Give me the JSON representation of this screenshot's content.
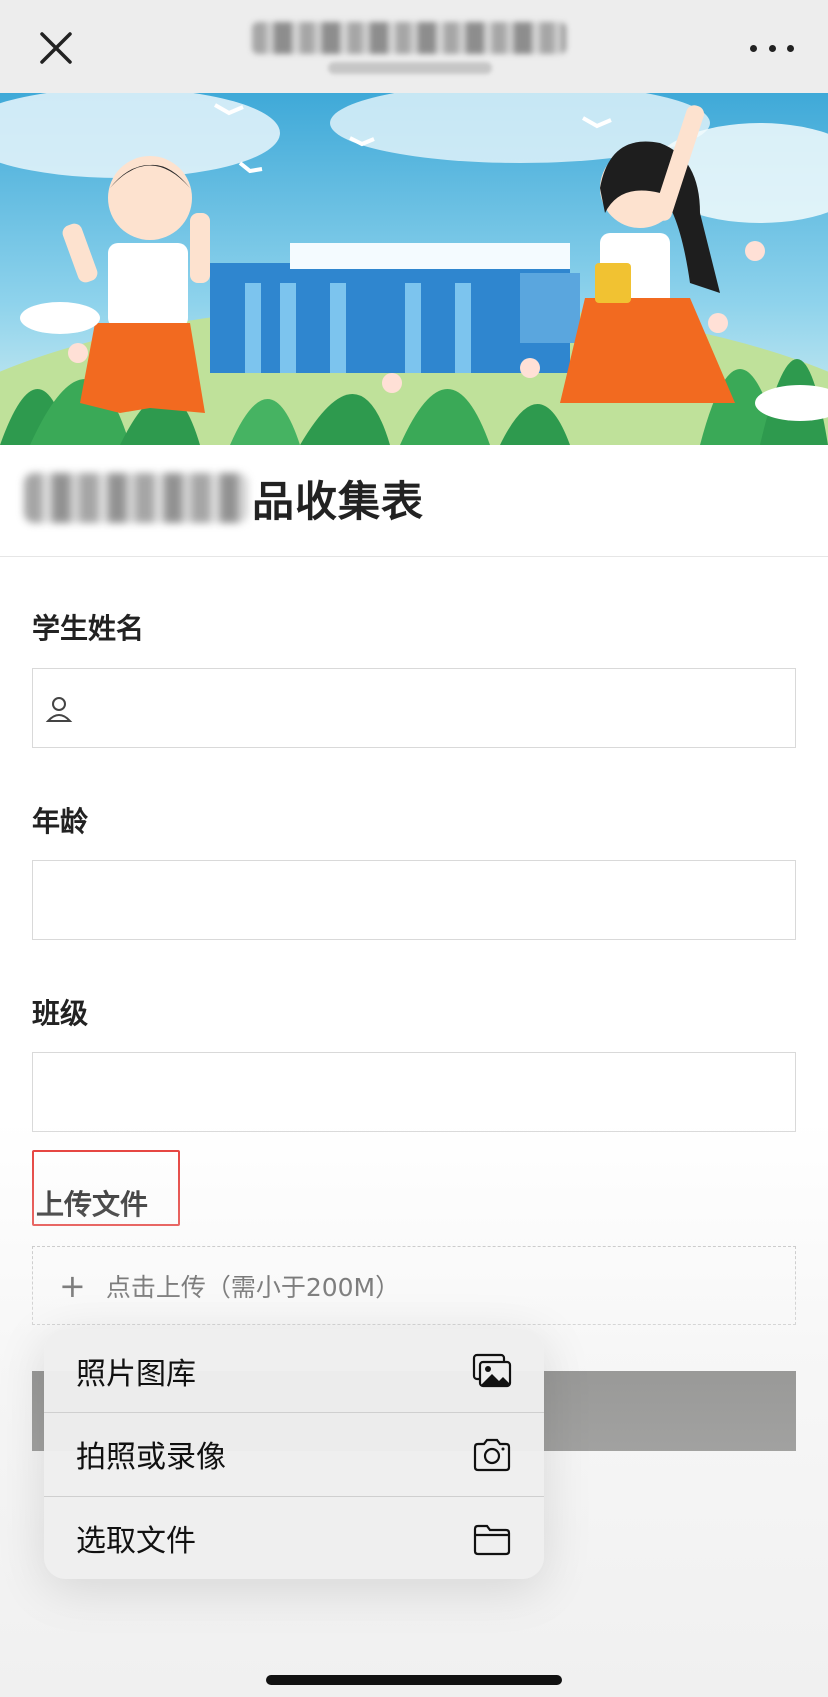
{
  "navbar": {
    "close_icon": "close-icon",
    "more_icon": "more-dots-icon"
  },
  "form": {
    "title_suffix": "品收集表",
    "fields": [
      {
        "label": "学生姓名",
        "icon": "user-icon",
        "value": ""
      },
      {
        "label": "年龄",
        "value": ""
      },
      {
        "label": "班级",
        "value": ""
      }
    ],
    "upload": {
      "label": "上传文件",
      "button_text": "点击上传（需小于200M）"
    }
  },
  "popup": {
    "items": [
      {
        "label": "照片图库",
        "icon": "photo-library-icon"
      },
      {
        "label": "拍照或录像",
        "icon": "camera-icon"
      },
      {
        "label": "选取文件",
        "icon": "folder-icon"
      }
    ]
  },
  "colors": {
    "accent_highlight": "#e53935",
    "submit_bar": "#2b2b28",
    "topbar_bg": "#ededed"
  }
}
